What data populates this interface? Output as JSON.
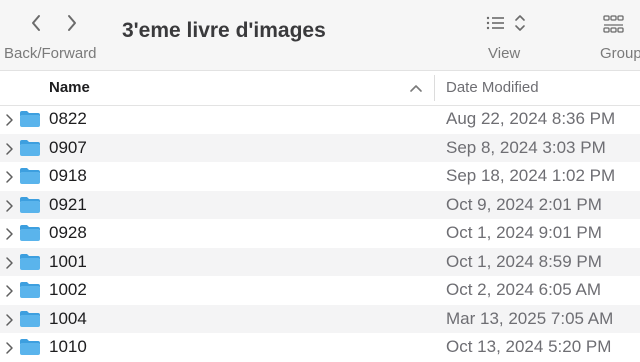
{
  "toolbar": {
    "title": "3'eme livre d'images",
    "back_forward_label": "Back/Forward",
    "view_label": "View",
    "group_label": "Group"
  },
  "columns": {
    "name": "Name",
    "date_modified": "Date Modified",
    "sort": "ascending"
  },
  "colors": {
    "folder": "#5ab4ec",
    "folder_tab": "#3d9fdf",
    "row_alt": "#f4f4f5"
  },
  "rows": [
    {
      "name": "0822",
      "date": "Aug 22, 2024 8:36 PM"
    },
    {
      "name": "0907",
      "date": "Sep 8, 2024 3:03 PM"
    },
    {
      "name": "0918",
      "date": "Sep 18, 2024 1:02 PM"
    },
    {
      "name": "0921",
      "date": "Oct 9, 2024 2:01 PM"
    },
    {
      "name": "0928",
      "date": "Oct 1, 2024 9:01 PM"
    },
    {
      "name": "1001",
      "date": "Oct 1, 2024 8:59 PM"
    },
    {
      "name": "1002",
      "date": "Oct 2, 2024 6:05 AM"
    },
    {
      "name": "1004",
      "date": "Mar 13, 2025 7:05 AM"
    },
    {
      "name": "1010",
      "date": "Oct 13, 2024 5:20 PM"
    }
  ]
}
